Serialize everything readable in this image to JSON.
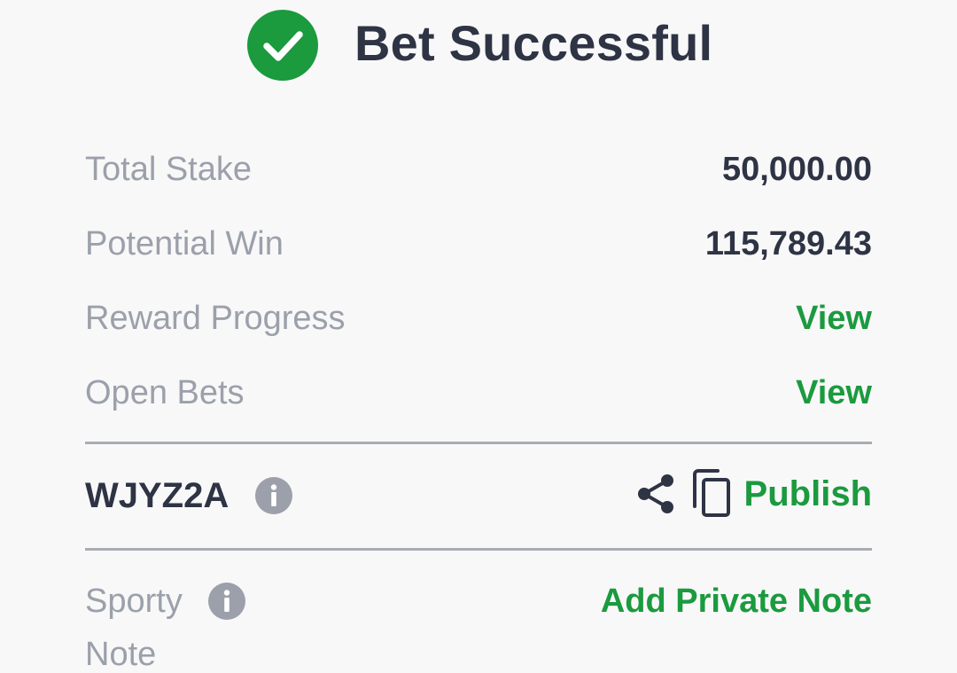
{
  "header": {
    "title": "Bet Successful",
    "icon": "check-circle-icon",
    "icon_color": "#1b9a3e"
  },
  "summary": {
    "total_stake_label": "Total Stake",
    "total_stake_value": "50,000.00",
    "potential_win_label": "Potential Win",
    "potential_win_value": "115,789.43",
    "reward_progress_label": "Reward Progress",
    "reward_progress_link": "View",
    "open_bets_label": "Open Bets",
    "open_bets_link": "View"
  },
  "booking": {
    "code": "WJYZ2A",
    "info_icon": "info-icon",
    "share_icon": "share-icon",
    "copy_icon": "copy-icon",
    "publish_label": "Publish"
  },
  "note": {
    "label_line1": "Sporty",
    "label_line2": "Note",
    "add_note_label": "Add Private Note"
  },
  "colors": {
    "accent": "#1b9a3e",
    "text_dark": "#2e3444",
    "text_muted": "#9ba0aa",
    "background": "#f8f8f9"
  }
}
